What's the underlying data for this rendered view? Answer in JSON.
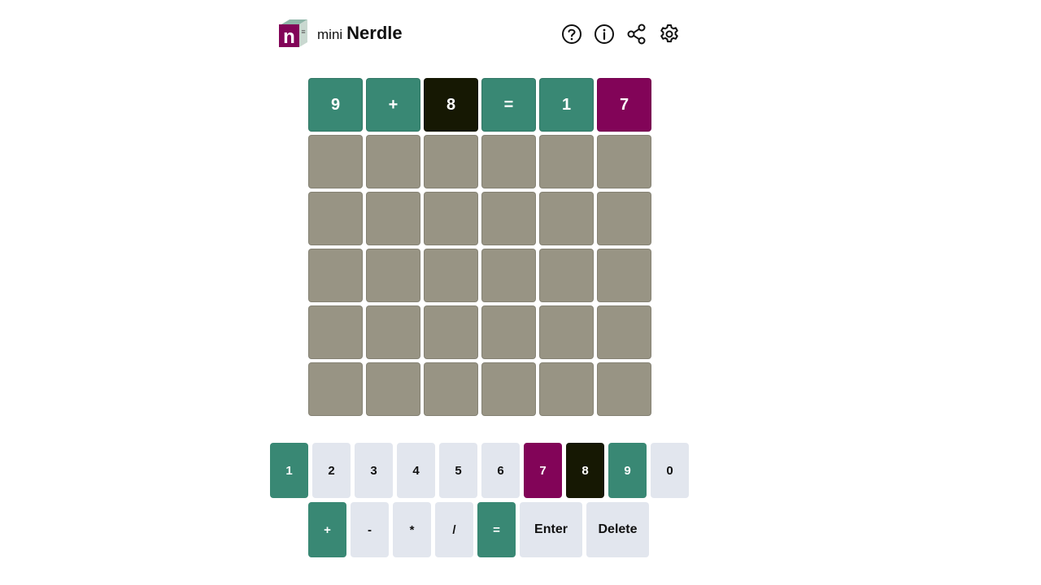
{
  "header": {
    "title_small": "mini",
    "title_big": "Nerdle",
    "logo_letter": "n",
    "icons": [
      "help-icon",
      "info-icon",
      "share-icon",
      "settings-icon"
    ]
  },
  "colors": {
    "correct": "#398874",
    "absent": "#161803",
    "present": "#820458",
    "empty_tile": "#989484",
    "key_default": "#e2e6ee"
  },
  "board": {
    "rows": [
      [
        {
          "char": "9",
          "state": "green"
        },
        {
          "char": "+",
          "state": "green"
        },
        {
          "char": "8",
          "state": "black"
        },
        {
          "char": "=",
          "state": "green"
        },
        {
          "char": "1",
          "state": "green"
        },
        {
          "char": "7",
          "state": "purple"
        }
      ],
      [
        {
          "char": "",
          "state": "empty"
        },
        {
          "char": "",
          "state": "empty"
        },
        {
          "char": "",
          "state": "empty"
        },
        {
          "char": "",
          "state": "empty"
        },
        {
          "char": "",
          "state": "empty"
        },
        {
          "char": "",
          "state": "empty"
        }
      ],
      [
        {
          "char": "",
          "state": "empty"
        },
        {
          "char": "",
          "state": "empty"
        },
        {
          "char": "",
          "state": "empty"
        },
        {
          "char": "",
          "state": "empty"
        },
        {
          "char": "",
          "state": "empty"
        },
        {
          "char": "",
          "state": "empty"
        }
      ],
      [
        {
          "char": "",
          "state": "empty"
        },
        {
          "char": "",
          "state": "empty"
        },
        {
          "char": "",
          "state": "empty"
        },
        {
          "char": "",
          "state": "empty"
        },
        {
          "char": "",
          "state": "empty"
        },
        {
          "char": "",
          "state": "empty"
        }
      ],
      [
        {
          "char": "",
          "state": "empty"
        },
        {
          "char": "",
          "state": "empty"
        },
        {
          "char": "",
          "state": "empty"
        },
        {
          "char": "",
          "state": "empty"
        },
        {
          "char": "",
          "state": "empty"
        },
        {
          "char": "",
          "state": "empty"
        }
      ],
      [
        {
          "char": "",
          "state": "empty"
        },
        {
          "char": "",
          "state": "empty"
        },
        {
          "char": "",
          "state": "empty"
        },
        {
          "char": "",
          "state": "empty"
        },
        {
          "char": "",
          "state": "empty"
        },
        {
          "char": "",
          "state": "empty"
        }
      ]
    ]
  },
  "keyboard": {
    "row1": [
      {
        "label": "1",
        "state": "green",
        "size": "num"
      },
      {
        "label": "2",
        "state": "default",
        "size": "num"
      },
      {
        "label": "3",
        "state": "default",
        "size": "num"
      },
      {
        "label": "4",
        "state": "default",
        "size": "num"
      },
      {
        "label": "5",
        "state": "default",
        "size": "num"
      },
      {
        "label": "6",
        "state": "default",
        "size": "num"
      },
      {
        "label": "7",
        "state": "purple",
        "size": "num"
      },
      {
        "label": "8",
        "state": "black",
        "size": "num"
      },
      {
        "label": "9",
        "state": "green",
        "size": "num"
      },
      {
        "label": "0",
        "state": "default",
        "size": "num"
      }
    ],
    "row2": [
      {
        "label": "+",
        "state": "green",
        "size": "op"
      },
      {
        "label": "-",
        "state": "default",
        "size": "op"
      },
      {
        "label": "*",
        "state": "default",
        "size": "op"
      },
      {
        "label": "/",
        "state": "default",
        "size": "op"
      },
      {
        "label": "=",
        "state": "green",
        "size": "op"
      },
      {
        "label": "Enter",
        "state": "default",
        "size": "wide"
      },
      {
        "label": "Delete",
        "state": "default",
        "size": "wide"
      }
    ]
  }
}
